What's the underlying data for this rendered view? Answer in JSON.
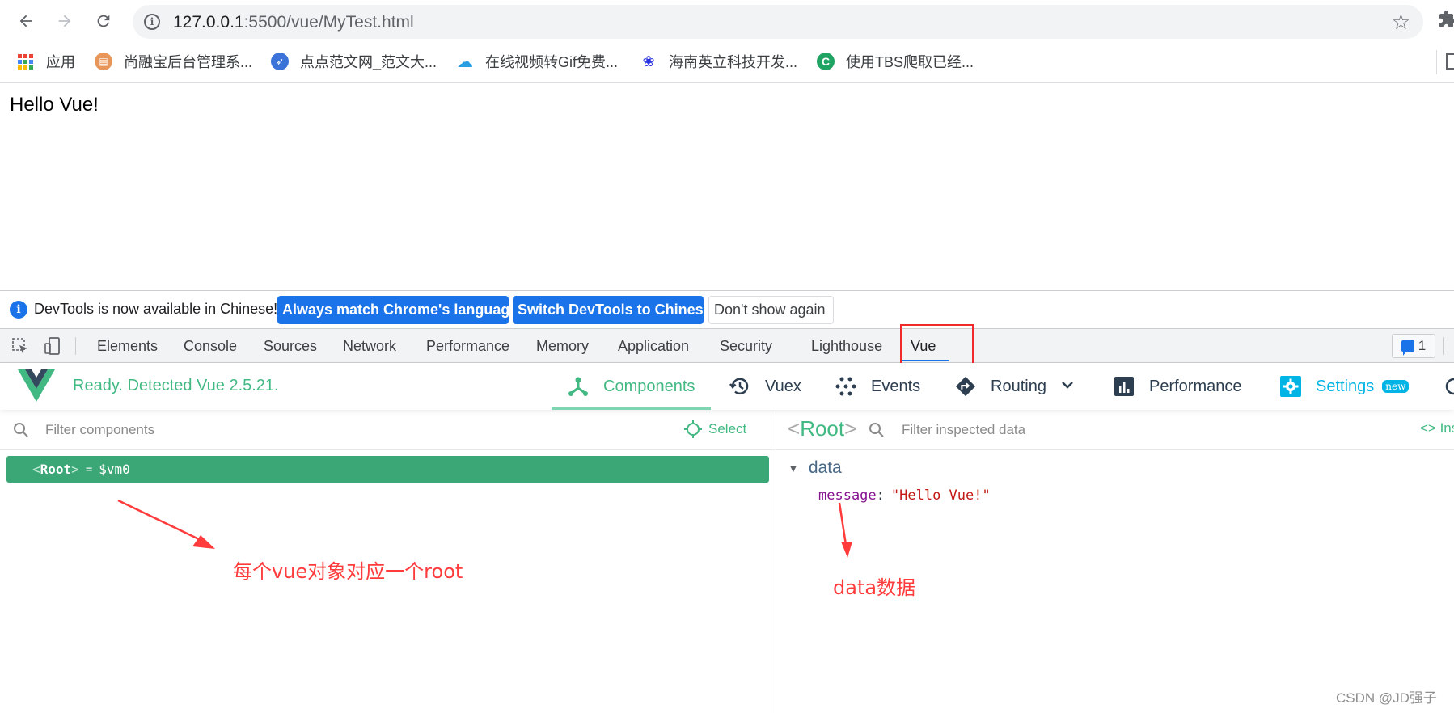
{
  "browser": {
    "url_host": "127.0.0.1",
    "url_path": ":5500/vue/MyTest.html",
    "bookmarks": [
      {
        "label": "应用",
        "icon": "apps-grid-icon"
      },
      {
        "label": "尚融宝后台管理系...",
        "icon": "document-icon",
        "color": "#e8965a"
      },
      {
        "label": "点点范文网_范文大...",
        "icon": "rocket-icon",
        "color": "#3b73d9"
      },
      {
        "label": "在线视频转Gif免费...",
        "icon": "cloud-icon",
        "color": "#2a9de0"
      },
      {
        "label": "海南英立科技开发...",
        "icon": "baidu-paw-icon",
        "color": "#2932e1"
      },
      {
        "label": "使用TBS爬取已经...",
        "icon": "c-logo-icon",
        "color": "#1fa463"
      }
    ]
  },
  "page": {
    "content_text": "Hello Vue!"
  },
  "infobar": {
    "message": "DevTools is now available in Chinese!",
    "btn_match": "Always match Chrome's language",
    "btn_switch": "Switch DevTools to Chinese",
    "btn_dismiss": "Don't show again"
  },
  "devtools": {
    "tabs": [
      {
        "label": "Elements"
      },
      {
        "label": "Console"
      },
      {
        "label": "Sources"
      },
      {
        "label": "Network"
      },
      {
        "label": "Performance"
      },
      {
        "label": "Memory"
      },
      {
        "label": "Application"
      },
      {
        "label": "Security"
      },
      {
        "label": "Lighthouse"
      },
      {
        "label": "Vue",
        "active": true
      }
    ],
    "issues_count": "1"
  },
  "vue": {
    "status": "Ready. Detected Vue 2.5.21.",
    "tabs": [
      {
        "label": "Components",
        "active": true
      },
      {
        "label": "Vuex"
      },
      {
        "label": "Events"
      },
      {
        "label": "Routing"
      },
      {
        "label": "Performance"
      },
      {
        "label": "Settings",
        "badge": "new"
      }
    ],
    "components": {
      "filter_placeholder": "Filter components",
      "select_label": "Select",
      "root_row": {
        "open": "<",
        "name": "Root",
        "close": ">",
        "eq": "=",
        "ref": "$vm0"
      }
    },
    "inspector": {
      "root_open": "<",
      "root_name": "Root",
      "root_close": ">",
      "filter_placeholder": "Filter inspected data",
      "inspect_dom_label": "<> Inspect DOM",
      "section": "data",
      "fields": [
        {
          "key": "message",
          "value": "\"Hello Vue!\""
        }
      ]
    }
  },
  "annotations": {
    "root_note": "每个vue对象对应一个root",
    "data_note": "data数据",
    "color": "#ff3b3b"
  },
  "watermark": "CSDN @JD强子",
  "colors": {
    "vue_green": "#42b983",
    "root_row_bg": "#3ba776",
    "chrome_blue": "#1a73e8",
    "settings_cyan": "#00b4e6"
  }
}
